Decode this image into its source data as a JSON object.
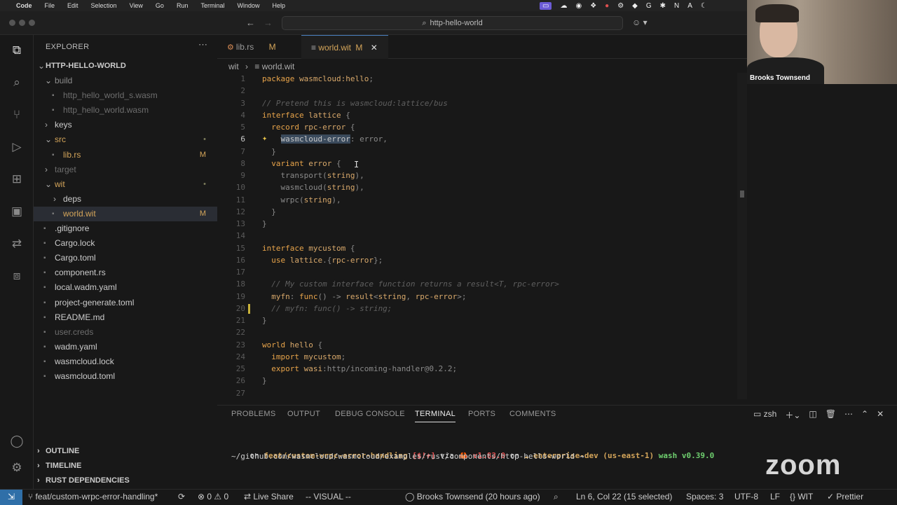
{
  "menubar": {
    "app": "Code",
    "items": [
      "File",
      "Edit",
      "Selection",
      "View",
      "Go",
      "Run",
      "Terminal",
      "Window",
      "Help"
    ]
  },
  "search": {
    "text": "http-hello-world"
  },
  "sidebar": {
    "title": "EXPLORER",
    "root": "HTTP-HELLO-WORLD",
    "items": [
      {
        "label": "build",
        "depth": 1,
        "kind": "folder-open",
        "color": "#8c8c8c",
        "mark": ""
      },
      {
        "label": "http_hello_world_s.wasm",
        "depth": 2,
        "kind": "file",
        "color": "#6d6d6d",
        "mark": ""
      },
      {
        "label": "http_hello_world.wasm",
        "depth": 2,
        "kind": "file",
        "color": "#6d6d6d",
        "mark": ""
      },
      {
        "label": "keys",
        "depth": 1,
        "kind": "folder",
        "color": "#cccccc",
        "mark": ""
      },
      {
        "label": "src",
        "depth": 1,
        "kind": "folder-open",
        "color": "#d4a55a",
        "mark": "•"
      },
      {
        "label": "lib.rs",
        "depth": 2,
        "kind": "file",
        "color": "#d4a55a",
        "mark": "M"
      },
      {
        "label": "target",
        "depth": 1,
        "kind": "folder",
        "color": "#6d6d6d",
        "mark": ""
      },
      {
        "label": "wit",
        "depth": 1,
        "kind": "folder-open",
        "color": "#d4a55a",
        "mark": "•"
      },
      {
        "label": "deps",
        "depth": 2,
        "kind": "folder",
        "color": "#cccccc",
        "mark": ""
      },
      {
        "label": "world.wit",
        "depth": 2,
        "kind": "file",
        "color": "#d4a55a",
        "mark": "M",
        "selected": true
      },
      {
        "label": ".gitignore",
        "depth": 1,
        "kind": "file",
        "color": "#cccccc",
        "mark": ""
      },
      {
        "label": "Cargo.lock",
        "depth": 1,
        "kind": "file",
        "color": "#cccccc",
        "mark": ""
      },
      {
        "label": "Cargo.toml",
        "depth": 1,
        "kind": "file",
        "color": "#cccccc",
        "mark": ""
      },
      {
        "label": "component.rs",
        "depth": 1,
        "kind": "file",
        "color": "#cccccc",
        "mark": ""
      },
      {
        "label": "local.wadm.yaml",
        "depth": 1,
        "kind": "file",
        "color": "#cccccc",
        "mark": ""
      },
      {
        "label": "project-generate.toml",
        "depth": 1,
        "kind": "file",
        "color": "#cccccc",
        "mark": ""
      },
      {
        "label": "README.md",
        "depth": 1,
        "kind": "file",
        "color": "#cccccc",
        "mark": ""
      },
      {
        "label": "user.creds",
        "depth": 1,
        "kind": "file",
        "color": "#6d6d6d",
        "mark": ""
      },
      {
        "label": "wadm.yaml",
        "depth": 1,
        "kind": "file",
        "color": "#cccccc",
        "mark": ""
      },
      {
        "label": "wasmcloud.lock",
        "depth": 1,
        "kind": "file",
        "color": "#cccccc",
        "mark": ""
      },
      {
        "label": "wasmcloud.toml",
        "depth": 1,
        "kind": "file",
        "color": "#cccccc",
        "mark": ""
      }
    ],
    "sections": [
      "OUTLINE",
      "TIMELINE",
      "RUST DEPENDENCIES"
    ]
  },
  "tabs": [
    {
      "label": "lib.rs",
      "mark": "M",
      "active": false
    },
    {
      "label": "world.wit",
      "mark": "M",
      "active": true
    }
  ],
  "breadcrumb": {
    "folder": "wit",
    "file": "world.wit"
  },
  "editor": {
    "lines": [
      {
        "n": "1",
        "segs": [
          [
            "kw",
            "package "
          ],
          [
            "ty",
            "wasmcloud:hello"
          ],
          [
            "pu",
            ";"
          ]
        ]
      },
      {
        "n": "2",
        "segs": []
      },
      {
        "n": "3",
        "segs": [
          [
            "cm",
            "// Pretend this is wasmcloud:lattice/bus"
          ]
        ]
      },
      {
        "n": "4",
        "segs": [
          [
            "kw",
            "interface "
          ],
          [
            "ty",
            "lattice"
          ],
          [
            "pu",
            " {"
          ]
        ]
      },
      {
        "n": "5",
        "segs": [
          [
            "pu",
            "  "
          ],
          [
            "kw",
            "record "
          ],
          [
            "ty",
            "rpc-error"
          ],
          [
            "pu",
            " {"
          ]
        ]
      },
      {
        "n": "6",
        "segs": [
          [
            "pu",
            "    "
          ],
          [
            "sel",
            "wasmcloud-error"
          ],
          [
            "pu",
            ": error,"
          ]
        ],
        "active": true
      },
      {
        "n": "7",
        "segs": [
          [
            "pu",
            "  }"
          ]
        ]
      },
      {
        "n": "8",
        "segs": [
          [
            "pu",
            "  "
          ],
          [
            "kw",
            "variant "
          ],
          [
            "ty",
            "error"
          ],
          [
            "pu",
            " {"
          ]
        ]
      },
      {
        "n": "9",
        "segs": [
          [
            "pu",
            "    transport("
          ],
          [
            "ty",
            "string"
          ],
          [
            "pu",
            "),"
          ]
        ]
      },
      {
        "n": "10",
        "segs": [
          [
            "pu",
            "    wasmcloud("
          ],
          [
            "ty",
            "string"
          ],
          [
            "pu",
            "),"
          ]
        ]
      },
      {
        "n": "11",
        "segs": [
          [
            "pu",
            "    wrpc("
          ],
          [
            "ty",
            "string"
          ],
          [
            "pu",
            "),"
          ]
        ]
      },
      {
        "n": "12",
        "segs": [
          [
            "pu",
            "  }"
          ]
        ]
      },
      {
        "n": "13",
        "segs": [
          [
            "pu",
            "}"
          ]
        ]
      },
      {
        "n": "14",
        "segs": []
      },
      {
        "n": "15",
        "segs": [
          [
            "kw",
            "interface "
          ],
          [
            "ty",
            "mycustom"
          ],
          [
            "pu",
            " {"
          ]
        ]
      },
      {
        "n": "16",
        "segs": [
          [
            "pu",
            "  "
          ],
          [
            "kw",
            "use "
          ],
          [
            "ty",
            "lattice"
          ],
          [
            "pu",
            ".{"
          ],
          [
            "ty",
            "rpc-error"
          ],
          [
            "pu",
            "};"
          ]
        ]
      },
      {
        "n": "17",
        "segs": []
      },
      {
        "n": "18",
        "segs": [
          [
            "cm",
            "  // My custom interface function returns a result<T, rpc-error>"
          ]
        ]
      },
      {
        "n": "19",
        "segs": [
          [
            "ty",
            "  myfn"
          ],
          [
            "pu",
            ": "
          ],
          [
            "kw",
            "func"
          ],
          [
            "pu",
            "() -> "
          ],
          [
            "ty",
            "result"
          ],
          [
            "pu",
            "<"
          ],
          [
            "ty",
            "string"
          ],
          [
            "pu",
            ", "
          ],
          [
            "ty",
            "rpc-error"
          ],
          [
            "pu",
            ">;"
          ]
        ]
      },
      {
        "n": "20",
        "segs": [
          [
            "cm",
            "  // myfn: func() -> string;"
          ]
        ]
      },
      {
        "n": "21",
        "segs": [
          [
            "pu",
            "}"
          ]
        ]
      },
      {
        "n": "22",
        "segs": []
      },
      {
        "n": "23",
        "segs": [
          [
            "kw",
            "world "
          ],
          [
            "ty",
            "hello"
          ],
          [
            "pu",
            " {"
          ]
        ]
      },
      {
        "n": "24",
        "segs": [
          [
            "pu",
            "  "
          ],
          [
            "kw",
            "import "
          ],
          [
            "ty",
            "mycustom"
          ],
          [
            "pu",
            ";"
          ]
        ]
      },
      {
        "n": "25",
        "segs": [
          [
            "pu",
            "  "
          ],
          [
            "kw",
            "export "
          ],
          [
            "ty",
            "wasi"
          ],
          [
            "pu",
            ":http/incoming-handler@0.2.2;"
          ]
        ]
      },
      {
        "n": "26",
        "segs": [
          [
            "pu",
            "}"
          ]
        ]
      },
      {
        "n": "27",
        "segs": []
      }
    ]
  },
  "panel": {
    "tabs": [
      "PROBLEMS",
      "OUTPUT",
      "DEBUG CONSOLE",
      "TERMINAL",
      "PORTS",
      "COMMENTS"
    ],
    "active_tab": "TERMINAL",
    "shell": "zsh",
    "prompt": {
      "on": "on ",
      "branch": "feat/custom-wrpc-error-handling",
      "status": " [$!+]",
      "via": " via ",
      "rust": "🦀 v1.83.0",
      "on2": " on ",
      "cloud": "☁ enterprise-dev (us-east-1)",
      "wash": " wash v0.39.0",
      "path": "~/github.com/wasmcloud/wasmcloud/examples/rust/components/http-hello-world →"
    }
  },
  "status": {
    "branch": "feat/custom-wrpc-error-handling*",
    "errors": "⊗ 0 ⚠ 0",
    "live_share": "Live Share",
    "mode": "-- VISUAL --",
    "blame": "Brooks Townsend (20 hours ago)",
    "position": "Ln 6, Col 22 (15 selected)",
    "spaces": "Spaces: 3",
    "encoding": "UTF-8",
    "eol": "LF",
    "language": "WIT",
    "formatter": "Prettier"
  },
  "webcam": {
    "name": "Brooks Townsend"
  },
  "zoom": {
    "logo": "zoom"
  }
}
